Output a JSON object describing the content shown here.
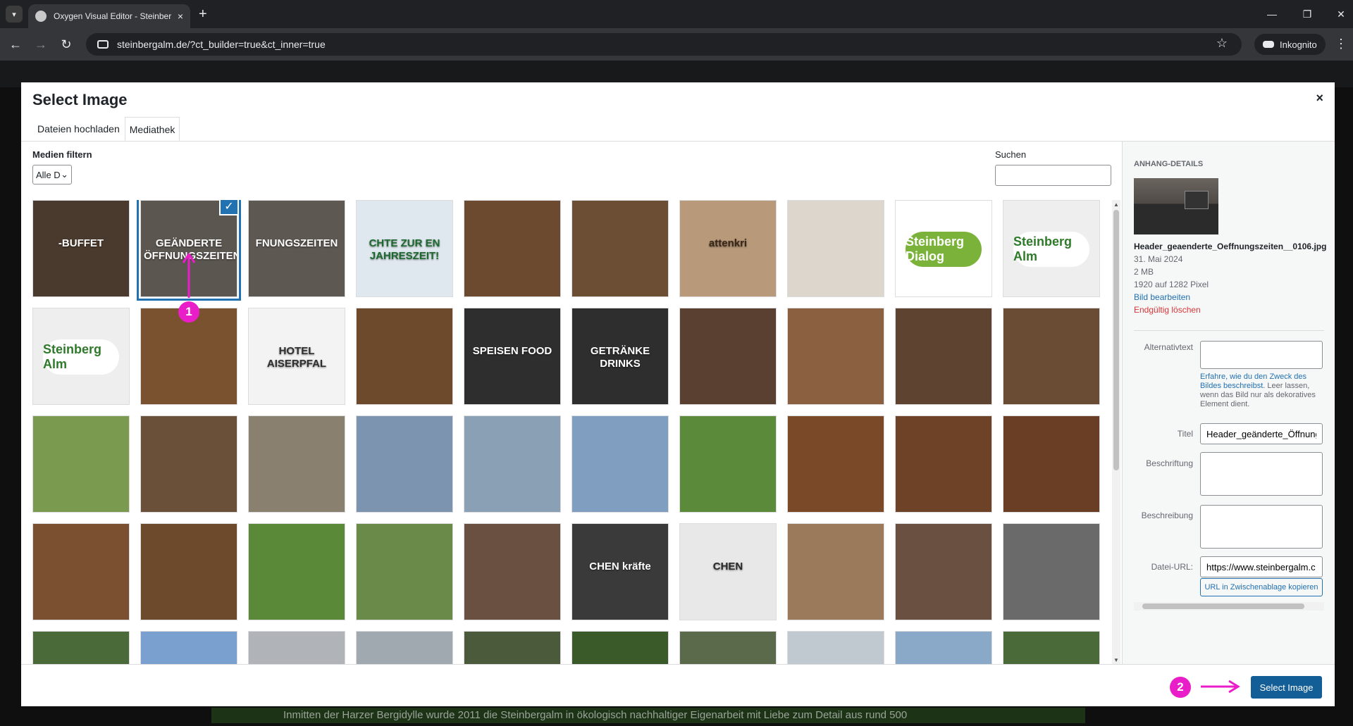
{
  "browser": {
    "tab_title": "Oxygen Visual Editor - Steinber",
    "tab_close": "×",
    "new_tab": "+",
    "url": "steinbergalm.de/?ct_builder=true&ct_inner=true",
    "incognito_label": "Inkognito",
    "star_icon": "☆",
    "menu_icon": "⋮"
  },
  "app": {
    "background_text": "Inmitten der Harzer Bergidylle wurde 2011 die Steinbergalm in ökologisch nachhaltiger Eigenarbeit mit Liebe zum Detail aus rund 500"
  },
  "modal": {
    "title": "Select Image",
    "close": "×",
    "tabs": [
      "Dateien hochladen",
      "Mediathek"
    ],
    "active_tab": "Mediathek",
    "filter_label": "Medien filtern",
    "filter_value": "Alle D",
    "search_label": "Suchen",
    "search_value": "",
    "select_button": "Select Image"
  },
  "grid": {
    "selected_index": 1,
    "checkmark": "✓",
    "thumbs": [
      {
        "text": "-BUFFET",
        "bg": "#4a3a2e",
        "fg": "#ffffff"
      },
      {
        "text": "GEÄNDERTE ÖFFNUNGSZEITEN",
        "bg": "#5b5650",
        "fg": "#ffffff"
      },
      {
        "text": "FNUNGSZEITEN",
        "bg": "#5d5852",
        "fg": "#ffffff"
      },
      {
        "text": "CHTE ZUR EN JAHRESZEIT!",
        "bg": "#dfe8ee",
        "fg": "#1c6a2f"
      },
      {
        "text": "",
        "bg": "#6b4a30",
        "fg": "#ffffff"
      },
      {
        "text": "",
        "bg": "#6b4e33",
        "fg": "#ffffff"
      },
      {
        "text": "attenkri",
        "bg": "#b89a7a",
        "fg": "#3a2618"
      },
      {
        "text": "",
        "bg": "#ddd6cc",
        "fg": "#333333"
      },
      {
        "text": "Steinberg Dialog",
        "bg": "#ffffff",
        "fg": "#ffffff",
        "logo": "#7bb33a"
      },
      {
        "text": "Steinberg Alm",
        "bg": "#eeeeee",
        "fg": "#2f7a2a",
        "logo": "#ffffff"
      },
      {
        "text": "Steinberg Alm",
        "bg": "#eeeeee",
        "fg": "#2f7a2a",
        "logo": "#ffffff"
      },
      {
        "text": "",
        "bg": "#7a5230",
        "fg": "#ffffff"
      },
      {
        "text": "HOTEL AISERPFAL",
        "bg": "#f3f3f3",
        "fg": "#2f2f2f"
      },
      {
        "text": "",
        "bg": "#6e4a2c",
        "fg": "#ffffff"
      },
      {
        "text": "SPEISEN FOOD",
        "bg": "#2e2e2e",
        "fg": "#ffffff"
      },
      {
        "text": "GETRÄNKE DRINKS",
        "bg": "#2e2e2e",
        "fg": "#ffffff"
      },
      {
        "text": "",
        "bg": "#5a4030",
        "fg": "#ffffff"
      },
      {
        "text": "",
        "bg": "#8a6040",
        "fg": "#ffffff"
      },
      {
        "text": "",
        "bg": "#5e4430",
        "fg": "#ffffff"
      },
      {
        "text": "",
        "bg": "#6a4c34",
        "fg": "#ffffff"
      },
      {
        "text": "",
        "bg": "#7a9a50",
        "fg": "#ffffff"
      },
      {
        "text": "",
        "bg": "#6a5038",
        "fg": "#ffffff"
      },
      {
        "text": "",
        "bg": "#8a8070",
        "fg": "#ffffff"
      },
      {
        "text": "",
        "bg": "#7d94b0",
        "fg": "#ffffff"
      },
      {
        "text": "",
        "bg": "#8aa0b4",
        "fg": "#ffffff"
      },
      {
        "text": "",
        "bg": "#7f9ec0",
        "fg": "#ffffff"
      },
      {
        "text": "",
        "bg": "#5a8a3a",
        "fg": "#ffffff"
      },
      {
        "text": "",
        "bg": "#7a4a28",
        "fg": "#ffffff"
      },
      {
        "text": "",
        "bg": "#6e4226",
        "fg": "#ffffff"
      },
      {
        "text": "",
        "bg": "#6a3e24",
        "fg": "#ffffff"
      },
      {
        "text": "",
        "bg": "#7a5030",
        "fg": "#ffffff"
      },
      {
        "text": "",
        "bg": "#6e4a2c",
        "fg": "#ffffff"
      },
      {
        "text": "",
        "bg": "#5a8a38",
        "fg": "#ffffff"
      },
      {
        "text": "",
        "bg": "#6a8a4a",
        "fg": "#ffffff"
      },
      {
        "text": "",
        "bg": "#6a5040",
        "fg": "#ffffff"
      },
      {
        "text": "CHEN kräfte",
        "bg": "#3a3a3a",
        "fg": "#ffffff"
      },
      {
        "text": "CHEN",
        "bg": "#e8e8e8",
        "fg": "#2a2a2a"
      },
      {
        "text": "",
        "bg": "#9a7a5a",
        "fg": "#ffffff"
      },
      {
        "text": "",
        "bg": "#6a5040",
        "fg": "#ffffff"
      },
      {
        "text": "",
        "bg": "#6a6a6a",
        "fg": "#ffffff"
      },
      {
        "text": "",
        "bg": "#4a6a3a",
        "fg": "#ffffff"
      },
      {
        "text": "",
        "bg": "#7aa0d0",
        "fg": "#ffffff"
      },
      {
        "text": "",
        "bg": "#b0b4b8",
        "fg": "#ffffff"
      },
      {
        "text": "",
        "bg": "#a0a8b0",
        "fg": "#ffffff"
      },
      {
        "text": "",
        "bg": "#4a5a3a",
        "fg": "#ffffff"
      },
      {
        "text": "",
        "bg": "#3a5a2a",
        "fg": "#ffffff"
      },
      {
        "text": "",
        "bg": "#5a6a4a",
        "fg": "#ffffff"
      },
      {
        "text": "",
        "bg": "#c0c8d0",
        "fg": "#ffffff"
      },
      {
        "text": "",
        "bg": "#8aa8c8",
        "fg": "#ffffff"
      },
      {
        "text": "",
        "bg": "#4a6a3a",
        "fg": "#ffffff"
      }
    ]
  },
  "details": {
    "heading": "ANHANG-DETAILS",
    "filename": "Header_geaenderte_Oeffnungszeiten__0106.jpg",
    "date": "31. Mai 2024",
    "size": "2 MB",
    "dimensions": "1920 auf 1282 Pixel",
    "edit_link": "Bild bearbeiten",
    "delete_link": "Endgültig löschen",
    "alt_label": "Alternativtext",
    "alt_value": "",
    "help_link": "Erfahre, wie du den Zweck des Bildes beschreibst",
    "help_rest": ". Leer lassen, wenn das Bild nur als dekoratives Element dient.",
    "title_label": "Titel",
    "title_value": "Header_geänderte_Öffnung",
    "caption_label": "Beschriftung",
    "caption_value": "",
    "description_label": "Beschreibung",
    "description_value": "",
    "url_label": "Datei-URL:",
    "url_value": "https://www.steinbergalm.c",
    "copy_button": "URL in Zwischenablage kopieren"
  },
  "annotations": {
    "marker_1": "1",
    "marker_2": "2",
    "color": "#e91ec8"
  },
  "colors": {
    "accent": "#2271b1",
    "primary_button": "#135e96",
    "danger": "#d63638"
  }
}
